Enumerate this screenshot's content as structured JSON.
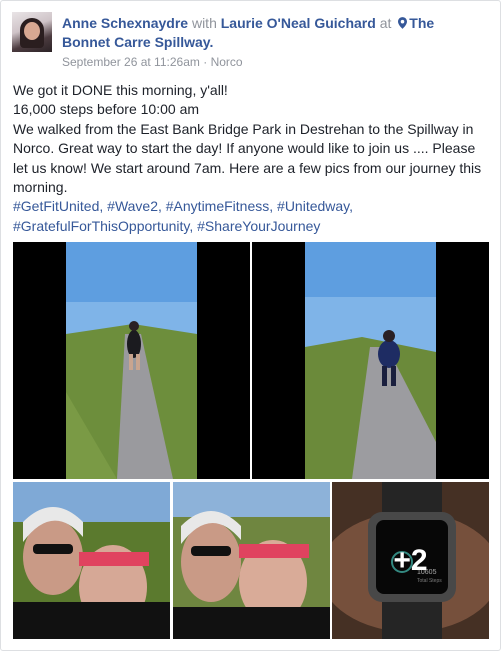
{
  "post": {
    "author": "Anne Schexnaydre",
    "with_word": "with",
    "tagged": "Laurie O'Neal Guichard",
    "at_word": "at",
    "place": "The Bonnet Carre Spillway.",
    "date": "September 26 at 11:26am",
    "separator": "·",
    "location": "Norco",
    "lines": [
      "We got it DONE this morning, y'all!",
      "16,000 steps before 10:00 am",
      "We walked from the East Bank Bridge Park in Destrehan to the Spillway in",
      "Norco. Great way to start the day! If anyone would like to join us .... Please",
      "let us know! We start around 7am. Here are a few pics from our journey this",
      "morning."
    ],
    "hashtags_line1": "#GetFitUnited, #Wave2, #AnytimeFitness, #Unitedway,",
    "hashtags_line2": "#GratefulForThisOpportunity, #ShareYourJourney"
  },
  "photos": {
    "more_count": "+2",
    "watch_steps": "10605",
    "watch_label": "Total Steps"
  },
  "colors": {
    "link": "#365899",
    "muted": "#90949c",
    "text": "#1d2129",
    "border": "#dddfe2"
  }
}
